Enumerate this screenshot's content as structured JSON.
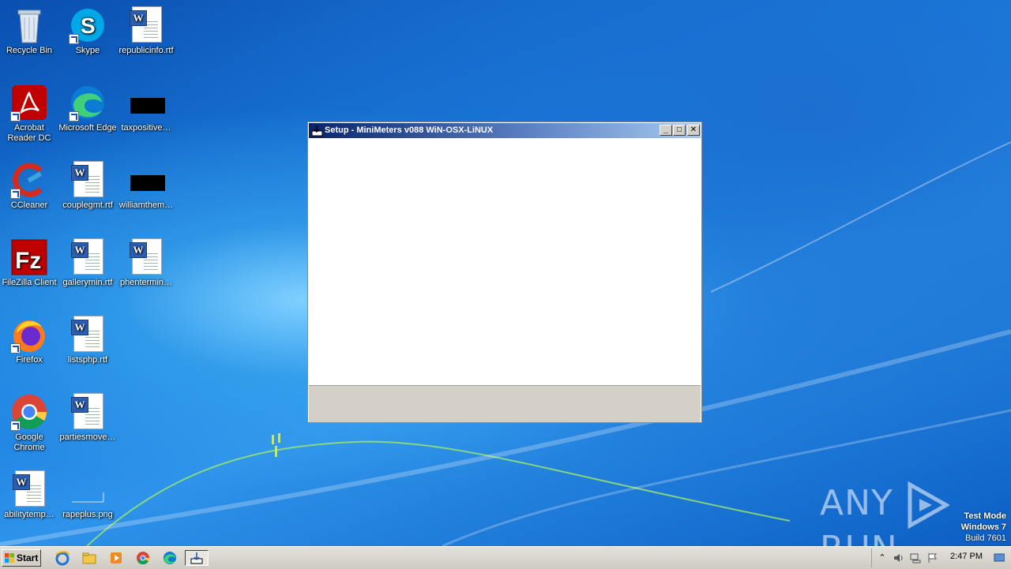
{
  "desktop": {
    "icons": [
      {
        "label": "Recycle Bin"
      },
      {
        "label": "Skype"
      },
      {
        "label": "republicinfo.rtf"
      },
      {
        "label": "Acrobat Reader DC"
      },
      {
        "label": "Microsoft Edge"
      },
      {
        "label": "taxpositive…"
      },
      {
        "label": "CCleaner"
      },
      {
        "label": "couplegmt.rtf"
      },
      {
        "label": "williamthem…"
      },
      {
        "label": "FileZilla Client"
      },
      {
        "label": "gallerymin.rtf"
      },
      {
        "label": "phentermin…"
      },
      {
        "label": "Firefox"
      },
      {
        "label": "listsphp.rtf"
      },
      {
        "label": "Google Chrome"
      },
      {
        "label": "partiesmove…"
      },
      {
        "label": "abilitytemp…"
      },
      {
        "label": "rapeplus.png"
      }
    ]
  },
  "window": {
    "title": "Setup - MiniMeters v088 WiN-OSX-LiNUX",
    "minimize": "_",
    "maximize": "□",
    "close": "✕"
  },
  "watermark": {
    "brand_left": "ANY",
    "brand_right": "RUN",
    "test_mode": "Test Mode",
    "os": "Windows 7",
    "build": "Build 7601"
  },
  "taskbar": {
    "start_label": "Start",
    "clock": "2:47 PM",
    "pinned": [
      "internet-explorer-icon",
      "explorer-folder-icon",
      "media-player-icon",
      "chrome-icon",
      "edge-icon",
      "setup-installer-icon"
    ]
  },
  "colors": {
    "titlebar_start": "#0a246a",
    "titlebar_end": "#a6caf0",
    "desktop_blue": "#1a7fe0"
  }
}
